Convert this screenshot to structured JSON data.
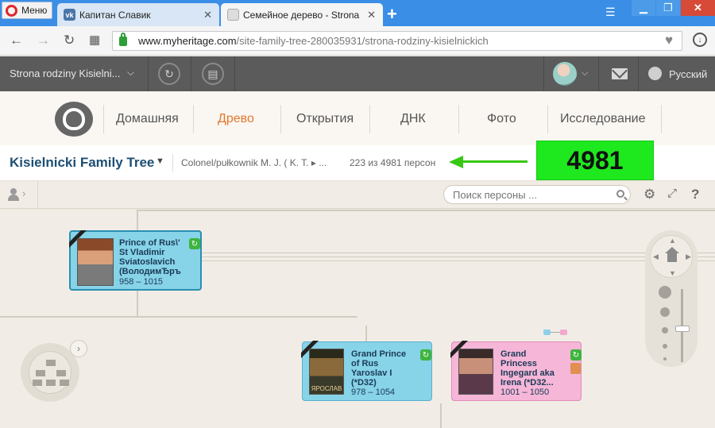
{
  "browser": {
    "menu_label": "Меню",
    "tabs": [
      {
        "title": "Капитан Славик",
        "icon": "vk-icon"
      },
      {
        "title": "Семейное дерево - Strona rodziny Kisielnicki",
        "icon": "document-icon"
      }
    ],
    "url_host": "www.myheritage.com",
    "url_path": "/site-family-tree-280035931/strona-rodziny-kisielnickich"
  },
  "topbar": {
    "site_name": "Strona rodziny Kisielni...",
    "language": "Русский"
  },
  "nav": {
    "items": [
      "Домашняя",
      "Древо",
      "Открытия",
      "ДНК",
      "Фото",
      "Исследование"
    ],
    "active": "Древо"
  },
  "tree_header": {
    "title": "Kisielnicki Family Tree",
    "breadcrumb": "Colonel/pułkownik M. J. ( K. T. ▸ ...",
    "person_count": "223 из 4981 персон",
    "highlight_badge": "4981",
    "highlight_color": "#1ee81e"
  },
  "toolbar": {
    "search_placeholder": "Поиск персоны ..."
  },
  "cards": [
    {
      "name": "Prince of Rus\\' St Vladimir Sviatoslavich (ВолодимЂръ",
      "dates": "958 – 1015",
      "gender": "male",
      "color": "#87d3e8"
    },
    {
      "name": "Grand Prince of Rus Yaroslav I (*D32)",
      "dates": "978 – 1054",
      "gender": "male",
      "color": "#87d3e8",
      "photo_caption": "ЯРОСЛАВ"
    },
    {
      "name": "Grand Princess Ingegard aka Irena (*D32...",
      "dates": "1001 – 1050",
      "gender": "female",
      "color": "#f6b6d8"
    }
  ]
}
